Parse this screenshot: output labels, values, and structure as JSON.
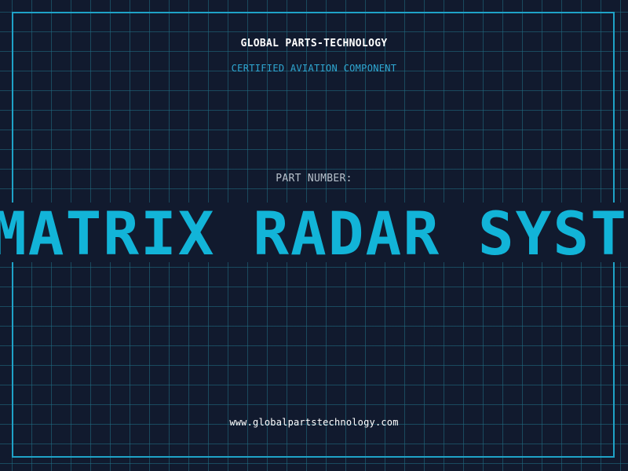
{
  "header": {
    "company": "GLOBAL PARTS-TECHNOLOGY",
    "tagline": "CERTIFIED AVIATION COMPONENT"
  },
  "part": {
    "label": "PART NUMBER:",
    "name": "MATRIX RADAR SYSTEM"
  },
  "footer": {
    "url": "www.globalpartstechnology.com"
  },
  "colors": {
    "background": "#111a2e",
    "grid": "#207086",
    "accent": "#12b4d8",
    "frame": "#1fa2c7"
  }
}
